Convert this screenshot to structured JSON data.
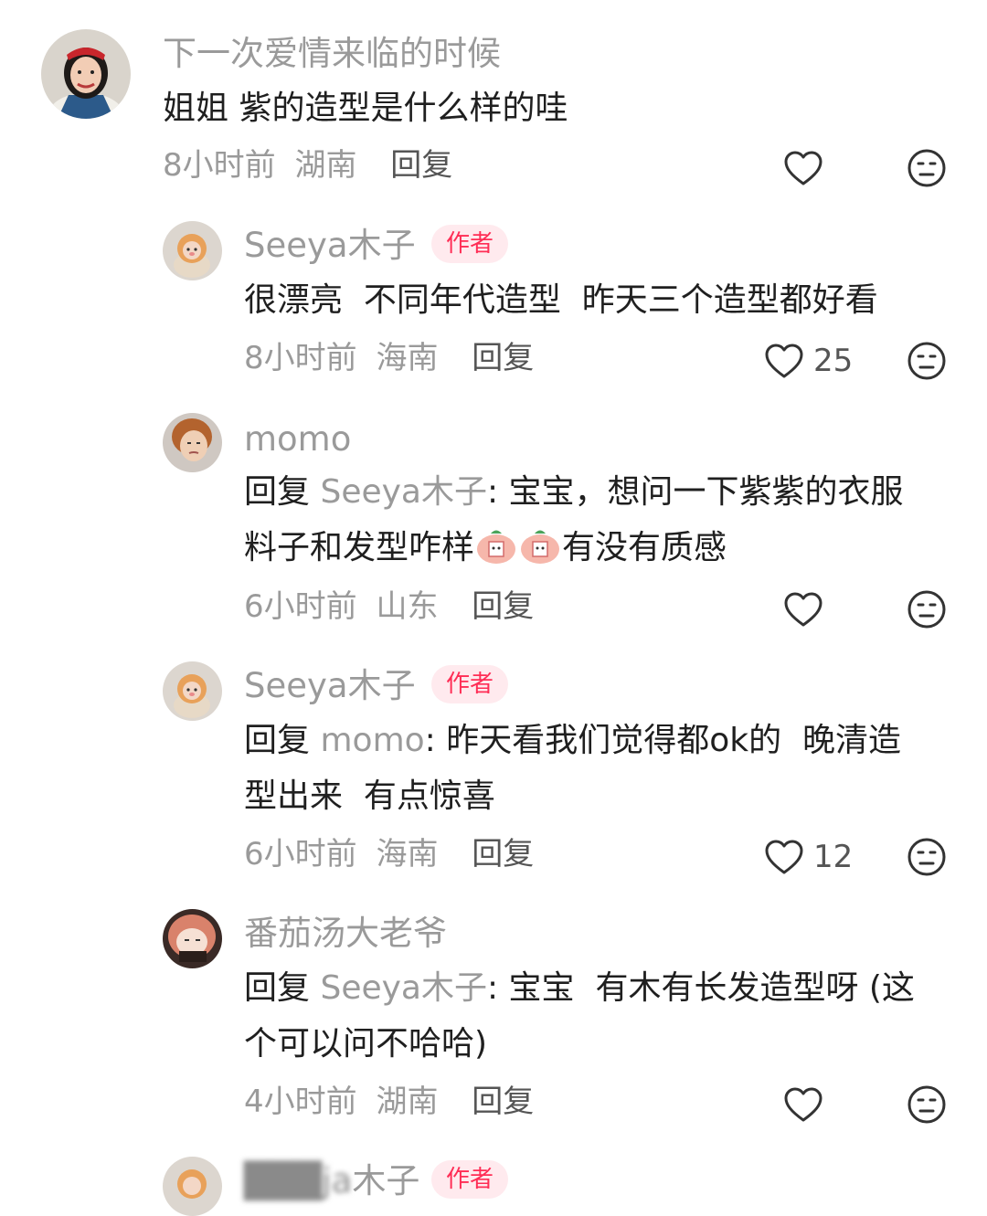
{
  "comments": [
    {
      "username": "下一次爱情来临的时候",
      "text": "姐姐 紫的造型是什么样的哇",
      "time": "8小时前",
      "location": "湖南",
      "reply_label": "回复",
      "likes": ""
    },
    {
      "username": "Seeya木子",
      "badge": "作者",
      "text": "很漂亮  不同年代造型  昨天三个造型都好看",
      "time": "8小时前",
      "location": "海南",
      "reply_label": "回复",
      "likes": "25"
    },
    {
      "username": "momo",
      "reply_prefix": "回复",
      "reply_to": "Seeya木子",
      "text_line1": ": 宝宝，想问一下紫紫的衣服",
      "text_line2a": "料子和发型咋样",
      "text_line2b": "有没有质感",
      "time": "6小时前",
      "location": "山东",
      "reply_label": "回复",
      "likes": ""
    },
    {
      "username": "Seeya木子",
      "badge": "作者",
      "reply_prefix": "回复",
      "reply_to": "momo",
      "text_line1": ": 昨天看我们觉得都ok的  晚清造",
      "text_line2": "型出来  有点惊喜",
      "time": "6小时前",
      "location": "海南",
      "reply_label": "回复",
      "likes": "12"
    },
    {
      "username": "番茄汤大老爷",
      "reply_prefix": "回复",
      "reply_to": "Seeya木子",
      "text_line1": ": 宝宝  有木有长发造型呀 (这",
      "text_line2": "个可以问不哈哈)",
      "time": "4小时前",
      "location": "湖南",
      "reply_label": "回复",
      "likes": ""
    },
    {
      "username_partial": "木子",
      "badge": "作者"
    }
  ],
  "icons": {
    "like": "heart-outline-icon",
    "dislike": "neutral-face-icon",
    "sticker": "peach-sticker"
  },
  "colors": {
    "badge_text": "#ff2d55",
    "badge_bg": "#ffeaee",
    "username": "#9a9a9a",
    "body_text": "#1f1f1f"
  }
}
